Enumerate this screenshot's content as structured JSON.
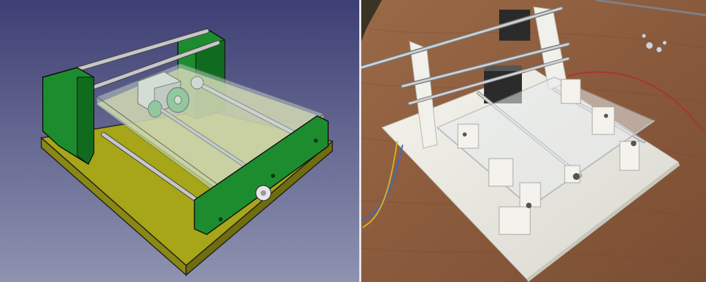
{
  "image": {
    "left_panel": {
      "background_top": "#3d3f74",
      "background_bottom": "#8f93b0",
      "colors": {
        "base": "#a7a518",
        "base_dark": "#6f6d0d",
        "support": "#1d8c2e",
        "support_dark": "#116b1f",
        "rod": "#c7c7c7",
        "plate_glass": "#cfe3da",
        "motor": "#d9d9d0",
        "pulley": "#5fb36b"
      }
    },
    "right_panel": {
      "table_color": "#8a5a3c",
      "base_board_color": "#f0efe8",
      "acrylic_color": "#e8ecef",
      "rod_color": "#b9bcc1",
      "motor_color": "#2a2a2a"
    }
  }
}
